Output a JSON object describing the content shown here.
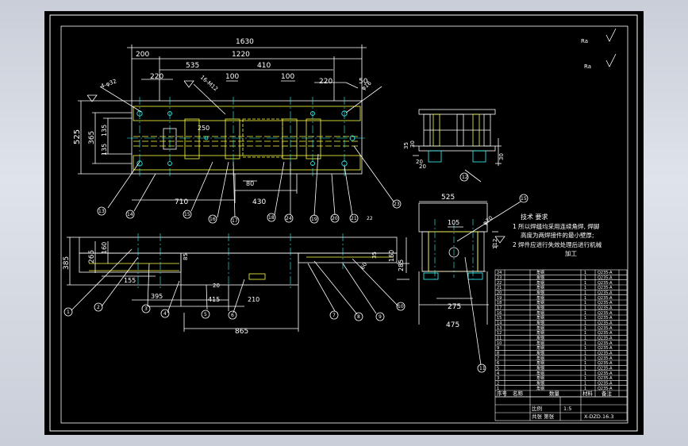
{
  "plan_view": {
    "dims_top": [
      "1630",
      "1220",
      "200",
      "220",
      "535",
      "410",
      "100",
      "100",
      "220",
      "50"
    ],
    "dims_left": [
      "525",
      "365",
      "135",
      "135"
    ],
    "dims_inner": [
      "250",
      "80"
    ],
    "dims_bottom": [
      "710",
      "430"
    ],
    "annotations": [
      "4-φ32",
      "16-M12",
      "φ16"
    ],
    "balloons": [
      "13",
      "14",
      "15",
      "16",
      "17",
      "18",
      "24",
      "19",
      "20",
      "21",
      "22",
      "23"
    ]
  },
  "front_view": {
    "dims_left": [
      "385",
      "265",
      "160",
      "155",
      "85"
    ],
    "dims_right": [
      "160",
      "35",
      "285",
      "60"
    ],
    "dims_bottom": [
      "20",
      "395",
      "415",
      "210",
      "865"
    ],
    "balloons": [
      "1",
      "2",
      "3",
      "4",
      "5",
      "6",
      "7",
      "8",
      "9",
      "10"
    ]
  },
  "side_detail": {
    "dims": [
      "35",
      "30",
      "20",
      "20",
      "30"
    ],
    "balloon": "12"
  },
  "side_view": {
    "dims": [
      "525",
      "105",
      "φ20",
      "112",
      "275",
      "475"
    ],
    "balloons": [
      "15",
      "11"
    ]
  },
  "roughness": {
    "sym1": "Ra",
    "sym2": "Ra"
  },
  "tech_requirements": {
    "title": "技术 要求",
    "lines": [
      "1 所以焊缝均采用连续角焊, 焊脚",
      "高度为两焊接件的最小壁厚;",
      "2 焊件应进行失效处理后进行机械",
      "加工"
    ]
  },
  "bom": {
    "numbers": [
      "24",
      "23",
      "22",
      "21",
      "20",
      "19",
      "18",
      "17",
      "16",
      "15",
      "14",
      "13",
      "12",
      "11",
      "10",
      "9",
      "8",
      "7",
      "6",
      "5",
      "4",
      "3",
      "2",
      "1"
    ],
    "mid_label": "角钢",
    "material": "Q235-A",
    "header": [
      "序号",
      "名称",
      "数量",
      "材料",
      "备注"
    ]
  },
  "title_block": {
    "scale_label": "比例",
    "scale": "1:5",
    "sheet": "共张 第张",
    "drawing_no": "X-DZD.16.3"
  }
}
